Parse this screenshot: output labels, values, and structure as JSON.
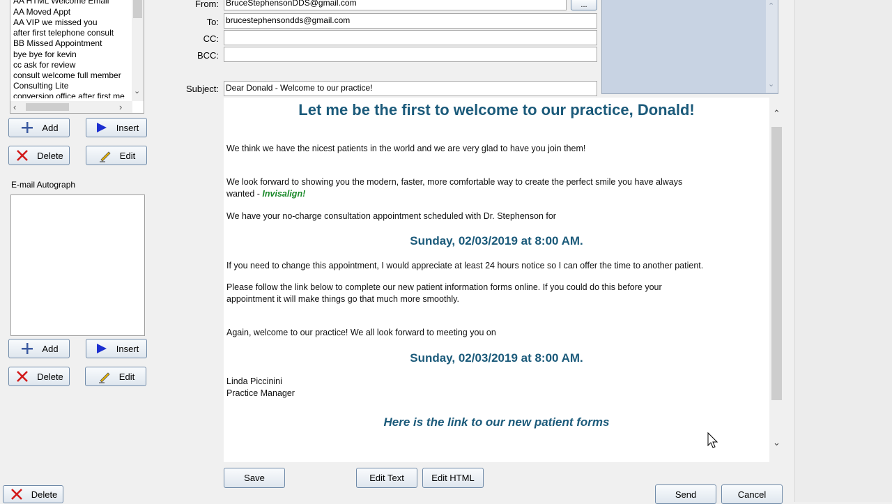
{
  "templates": {
    "items": [
      "AA HTML Welcome Email",
      "AA Moved Appt",
      "AA VIP we missed you",
      "after first telephone consult",
      "BB Missed Appointment",
      "bye bye for kevin",
      "cc ask for review",
      "consult welcome full member",
      "Consulting Lite",
      "conversion office after first me"
    ]
  },
  "buttons": {
    "add": "Add",
    "insert": "Insert",
    "delete": "Delete",
    "edit": "Edit",
    "save": "Save",
    "edit_text": "Edit Text",
    "edit_html": "Edit HTML",
    "send": "Send",
    "cancel": "Cancel",
    "browse": "..."
  },
  "autograph_label": "E-mail Autograph",
  "fields": {
    "from_label": "From:",
    "from_value": "BruceStephensonDDS@gmail.com",
    "to_label": "To:",
    "to_value": "brucestephensondds@gmail.com",
    "cc_label": "CC:",
    "cc_value": "",
    "bcc_label": "BCC:",
    "bcc_value": "",
    "subject_label": "Subject:",
    "subject_value": "Dear Donald - Welcome to our practice!"
  },
  "email": {
    "heading": "Let me be the first to welcome to our practice, Donald!",
    "p1": "We think we have the nicest patients in the world and we are very glad to have you join them!",
    "p2a": "We look forward to showing you the modern, faster, more comfortable way to create the perfect smile you have always",
    "p2b": "wanted  - ",
    "p2_brand": "Invisalign!",
    "p3": "We have your no-charge consultation appointment scheduled with Dr. Stephenson for",
    "appt1": "Sunday, 02/03/2019 at 8:00 AM.",
    "p4": "If you need to change this appointment, I would appreciate at least 24 hours notice so I can offer the time to another patient.",
    "p5a": "Please follow the link below to complete our new patient information forms online. If you could do this before your",
    "p5b": "appointment it will make things go that much more smoothly.",
    "p6": "Again, welcome to our practice!  We all look forward to meeting you on",
    "appt2": "Sunday, 02/03/2019 at 8:00 AM.",
    "sig_name": "Linda Piccinini",
    "sig_title": "Practice Manager",
    "link": "Here is the link to our new patient forms"
  },
  "colors": {
    "heading": "#1b5a7a",
    "brand": "#1a8a2a",
    "preview": "#c8d3e3"
  }
}
